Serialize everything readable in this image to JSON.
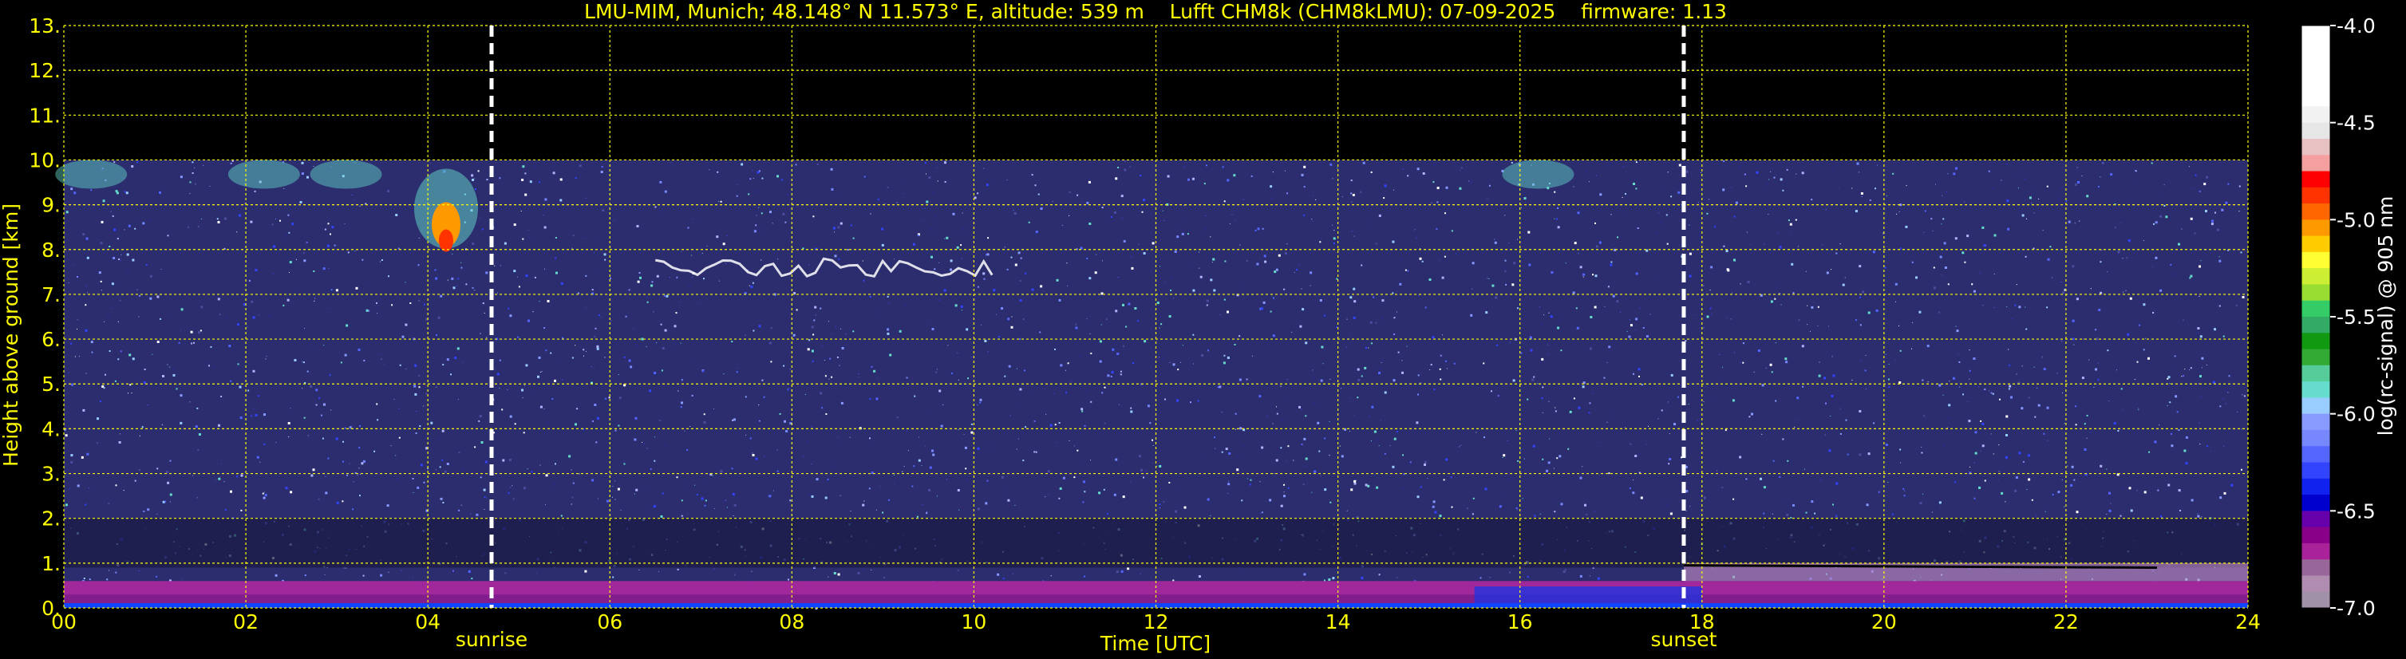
{
  "chart_data": {
    "type": "heatmap",
    "title": "LMU-MIM, Munich; 48.148° N 11.573° E, altitude: 539 m    Lufft CHM8k (CHM8kLMU): 07-09-2025    firmware: 1.13",
    "xlabel": "Time [UTC]",
    "ylabel": "Height above ground [km]",
    "xlim": [
      0,
      24
    ],
    "ylim": [
      0,
      13
    ],
    "x_ticks": [
      "00",
      "02",
      "04",
      "06",
      "08",
      "10",
      "12",
      "14",
      "16",
      "18",
      "20",
      "22",
      "24"
    ],
    "y_ticks": [
      "0.",
      "1.",
      "2.",
      "3.",
      "4.",
      "5.",
      "6.",
      "7.",
      "8.",
      "9.",
      "10.",
      "11.",
      "12.",
      "13."
    ],
    "grid": true,
    "data_top_km": 10.0,
    "events": [
      {
        "label": "sunrise",
        "time": 4.7
      },
      {
        "label": "sunset",
        "time": 17.8
      }
    ],
    "colorbar": {
      "label": "log(rc-signal) @ 905 nm",
      "range": [
        -7.0,
        -4.0
      ],
      "ticks": [
        "-4.0",
        "-4.5",
        "-5.0",
        "-5.5",
        "-6.0",
        "-6.5",
        "-7.0"
      ],
      "colors": [
        "#ffffff",
        "#ffffff",
        "#ffffff",
        "#ffffff",
        "#ffffff",
        "#f2f2f2",
        "#e6e6e6",
        "#e8c2c2",
        "#f5a0a0",
        "#ff0000",
        "#ff3300",
        "#ff6600",
        "#ff9900",
        "#ffcc00",
        "#ffff33",
        "#ccee33",
        "#99dd33",
        "#33cc66",
        "#33aa66",
        "#119911",
        "#33aa33",
        "#55cc99",
        "#66ddcc",
        "#99ccff",
        "#8899ff",
        "#7788ff",
        "#5566ff",
        "#3344ff",
        "#1122ee",
        "#0000cc",
        "#6600aa",
        "#880088",
        "#aa2299",
        "#996699",
        "#b08cb0",
        "#a090a8"
      ]
    },
    "colors": {
      "text": "#ffff00",
      "grid": "#ffff00",
      "event_line": "#ffffff",
      "background": "#000000",
      "signal_base": "#2b2d6e",
      "boundary_layer": "#a0289a"
    },
    "features": [
      {
        "type": "boundary_layer",
        "from_time": 0,
        "to_time": 24,
        "top_km": 0.6
      },
      {
        "type": "residual_layer",
        "from_time": 17.8,
        "to_time": 24,
        "top_km": 1.0
      },
      {
        "type": "cloud_patch",
        "time": 4.2,
        "height_km": 8.2
      },
      {
        "type": "cloud_band",
        "from_time": 6.5,
        "to_time": 10.2,
        "height_km": 7.6
      }
    ]
  }
}
